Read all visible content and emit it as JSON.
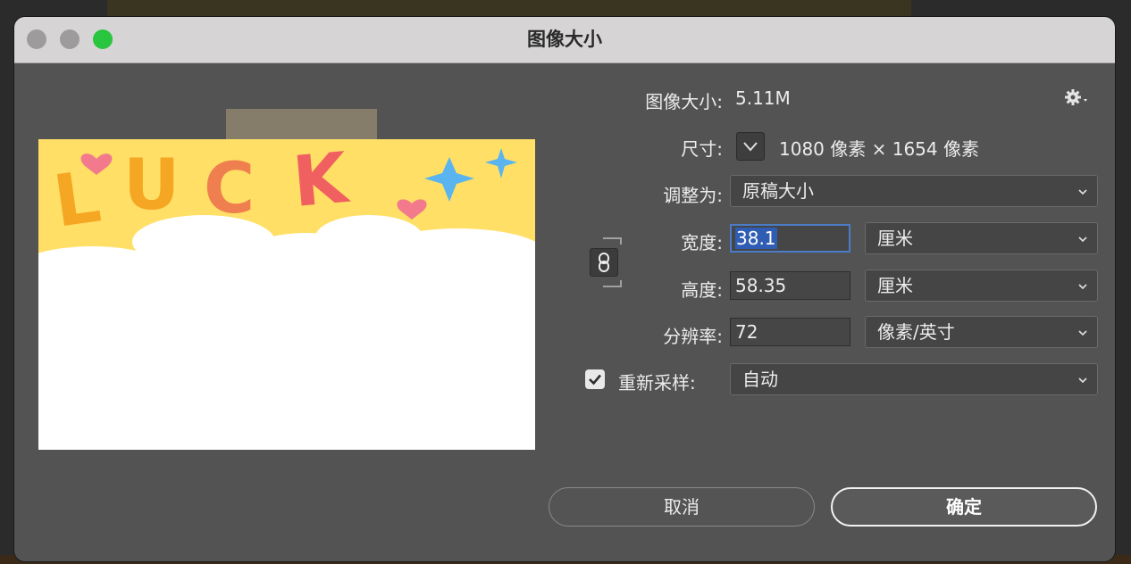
{
  "window": {
    "title": "图像大小"
  },
  "info": {
    "size_label": "图像大小:",
    "size_value": "5.11M"
  },
  "dimensions": {
    "label": "尺寸:",
    "value": "1080 像素 × 1654 像素"
  },
  "fit_to": {
    "label": "调整为:",
    "value": "原稿大小"
  },
  "width": {
    "label": "宽度:",
    "value": "38.1",
    "unit": "厘米"
  },
  "height": {
    "label": "高度:",
    "value": "58.35",
    "unit": "厘米"
  },
  "resolution": {
    "label": "分辨率:",
    "value": "72",
    "unit": "像素/英寸"
  },
  "resample": {
    "label": "重新采样:",
    "checked": true,
    "value": "自动"
  },
  "buttons": {
    "cancel": "取消",
    "ok": "确定"
  },
  "preview": {
    "text": "LUCK",
    "colors": {
      "background": "#ffdf66",
      "cloud": "#ffffff",
      "l": "#f5a623",
      "u": "#f5a623",
      "c": "#f07f4f",
      "k": "#f06060",
      "heart": "#f27a8c",
      "star": "#5ab4f0",
      "tab": "#857d6a"
    }
  },
  "icons": {
    "gear": "gear-icon",
    "link": "link-icon",
    "check": "checkmark-icon",
    "chevron": "chevron-down-icon"
  }
}
